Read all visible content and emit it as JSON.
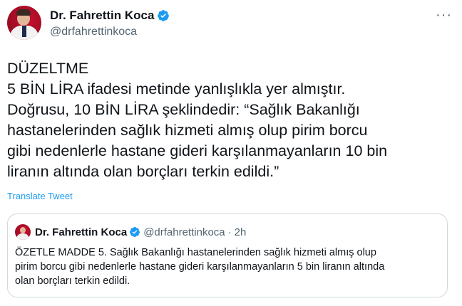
{
  "author": {
    "display_name": "Dr. Fahrettin Koca",
    "handle": "@drfahrettinkoca"
  },
  "tweet": {
    "text": "DÜZELTME\n5 BİN LİRA ifadesi metinde yanlışlıkla yer almıştır.\nDoğrusu, 10 BİN LİRA şeklindedir: “Sağlık Bakanlığı\nhastanelerinden sağlık hizmeti almış olup pirim borcu\ngibi nedenlerle hastane gideri karşılanmayanların 10 bin\nliranın altında olan borçları terkin edildi.”",
    "translate_label": "Translate Tweet"
  },
  "quoted": {
    "display_name": "Dr. Fahrettin Koca",
    "handle": "@drfahrettinkoca",
    "separator": "·",
    "time": "2h",
    "text": "ÖZETLE MADDE 5. Sağlık Bakanlığı hastanelerinden sağlık hizmeti almış olup\npirim borcu gibi nedenlerle hastane gideri karşılanmayanların 5 bin liranın altında\nolan borçları terkin edildi."
  },
  "icons": {
    "verified": "verified-badge-icon",
    "more": "more-options-icon"
  },
  "colors": {
    "accent": "#1d9bf0",
    "secondary_text": "#536471",
    "border": "#cfd9de"
  }
}
